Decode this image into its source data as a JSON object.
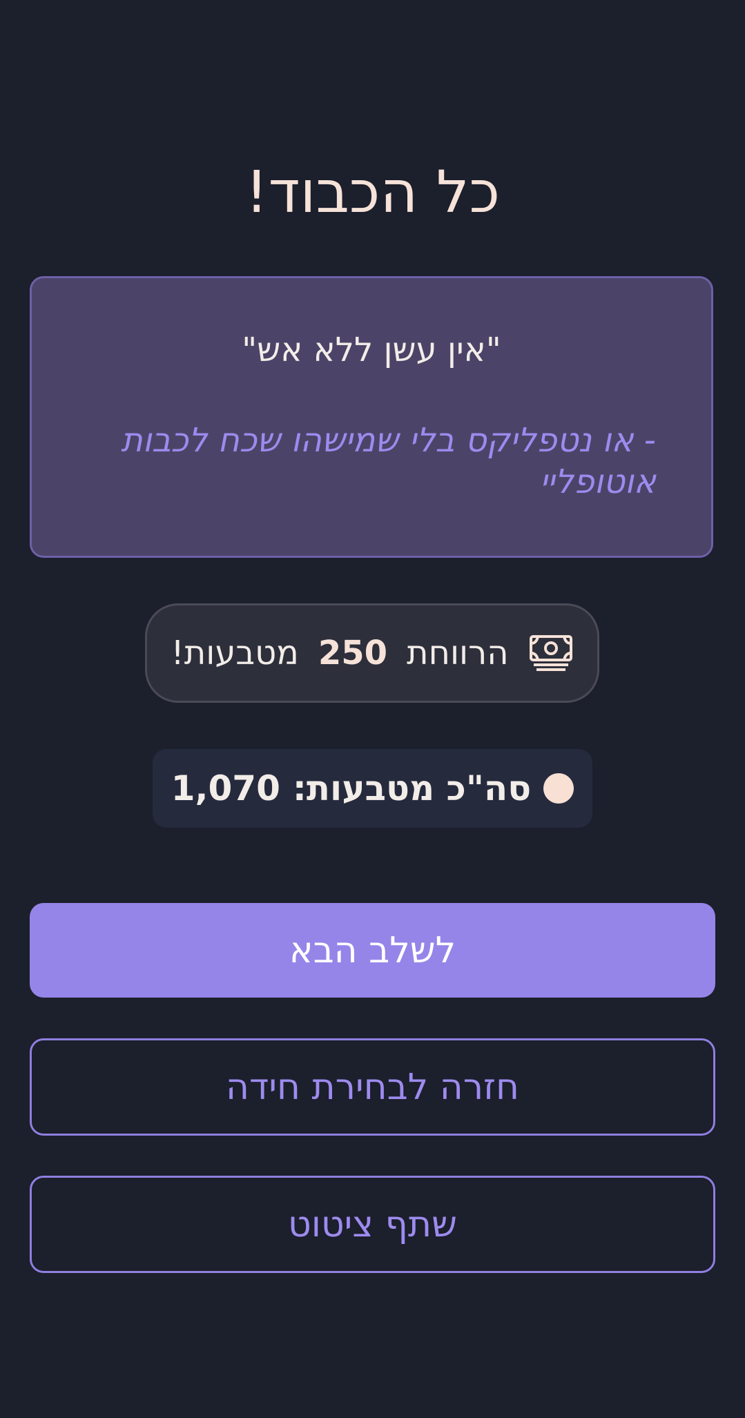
{
  "title": "כל הכבוד!",
  "quote": {
    "text": "\"אין עשן ללא אש\"",
    "author": "- או נטפליקס בלי שמישהו שכח לכבות אוטופליי"
  },
  "earned": {
    "prefix": "הרווחת",
    "amount": "250",
    "suffix": "מטבעות!",
    "icon": "money-bill-icon"
  },
  "total": {
    "label": "סה\"כ מטבעות:",
    "value": "1,070",
    "icon": "coin-icon"
  },
  "buttons": {
    "next": "לשלב הבא",
    "back": "חזרה לבחירת חידה",
    "share": "שתף ציטוט"
  },
  "colors": {
    "background": "#1c1f2c",
    "accent": "#9585e9",
    "quote_card": "#4b4468",
    "title": "#f6e2d8"
  }
}
